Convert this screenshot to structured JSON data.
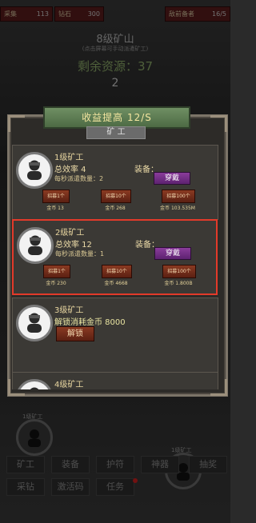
{
  "top_bar": {
    "items": [
      {
        "label": "采集",
        "value": "113"
      },
      {
        "label": "钻石",
        "value": "300"
      },
      {
        "label": "敌前备者",
        "value": "16/5"
      }
    ]
  },
  "mine": {
    "title": "8级矿山",
    "hint": "(点击屏幕可手动派遣矿工)",
    "remaining": "剩余资源：37",
    "number": "2"
  },
  "panel": {
    "ribbon": "收益提高 12/S",
    "tab": "矿 工"
  },
  "miners": [
    {
      "name": "1级矿工",
      "efficiency": "总效率 4",
      "rate": "每秒派遣数量：2",
      "equip_label": "装备：",
      "wear": "穿戴",
      "recruit": [
        {
          "label": "招募1个",
          "cost": "金币 13"
        },
        {
          "label": "招募10个",
          "cost": "金币 268"
        },
        {
          "label": "招募100个",
          "cost": "金币 103.535M"
        }
      ]
    },
    {
      "name": "2级矿工",
      "efficiency": "总效率 12",
      "rate": "每秒派遣数量：1",
      "equip_label": "装备：",
      "wear": "穿戴",
      "recruit": [
        {
          "label": "招募1个",
          "cost": "金币 230"
        },
        {
          "label": "招募10个",
          "cost": "金币 4668"
        },
        {
          "label": "招募100个",
          "cost": "金币 1.800B"
        }
      ]
    },
    {
      "name": "3级矿工",
      "unlock_text": "解锁消耗金币 8000",
      "unlock_btn": "解锁"
    },
    {
      "name": "4级矿工"
    }
  ],
  "bottom": {
    "left_label": "1级矿工",
    "right_label": "1级矿工",
    "menu_row1": [
      "矿工",
      "装备",
      "护符",
      "神器",
      "抽奖"
    ],
    "menu_row2": [
      "采钻",
      "激活码",
      "任务"
    ]
  }
}
